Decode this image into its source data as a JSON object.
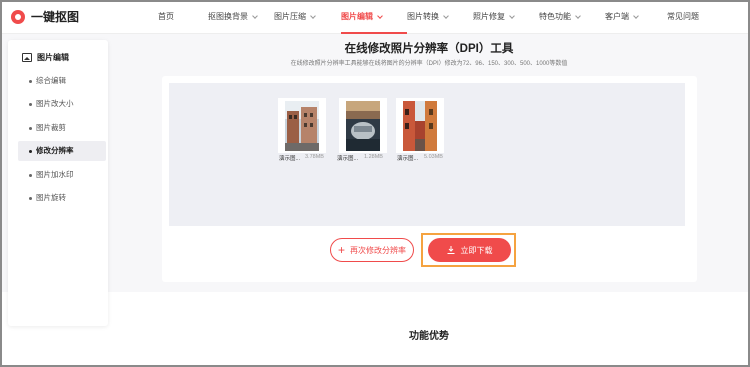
{
  "header": {
    "logo_text": "一键抠图",
    "nav": [
      {
        "label": "首页",
        "dropdown": false,
        "active": false
      },
      {
        "label": "抠图换背景",
        "dropdown": true,
        "active": false
      },
      {
        "label": "图片压缩",
        "dropdown": true,
        "active": false
      },
      {
        "label": "图片编辑",
        "dropdown": true,
        "active": true
      },
      {
        "label": "图片转换",
        "dropdown": true,
        "active": false
      },
      {
        "label": "照片修复",
        "dropdown": true,
        "active": false
      },
      {
        "label": "特色功能",
        "dropdown": true,
        "active": false
      },
      {
        "label": "客户端",
        "dropdown": true,
        "active": false
      },
      {
        "label": "常见问题",
        "dropdown": false,
        "active": false
      }
    ]
  },
  "sidebar": {
    "heading": "图片编辑",
    "items": [
      {
        "label": "综合编辑",
        "active": false
      },
      {
        "label": "图片改大小",
        "active": false
      },
      {
        "label": "图片裁剪",
        "active": false
      },
      {
        "label": "修改分辨率",
        "active": true
      },
      {
        "label": "图片加水印",
        "active": false
      },
      {
        "label": "图片旋转",
        "active": false
      }
    ]
  },
  "main": {
    "title": "在线修改照片分辨率（DPI）工具",
    "subtitle": "在线修改照片分辨率工具能够在线将图片的分辨率（DPI）修改为72、96、150、300、500、1000等数值",
    "files": [
      {
        "name": "演示图...",
        "size": "3.78MB",
        "image": "city-street-photo"
      },
      {
        "name": "演示图...",
        "size": "1.28MB",
        "image": "harbor-photo"
      },
      {
        "name": "演示图...",
        "size": "5.03MB",
        "image": "alley-photo"
      }
    ],
    "again_button": "再次修改分辨率",
    "download_button": "立即下载",
    "features_heading": "功能优势"
  },
  "colors": {
    "accent": "#f04b4b",
    "highlight": "#f5a340"
  }
}
